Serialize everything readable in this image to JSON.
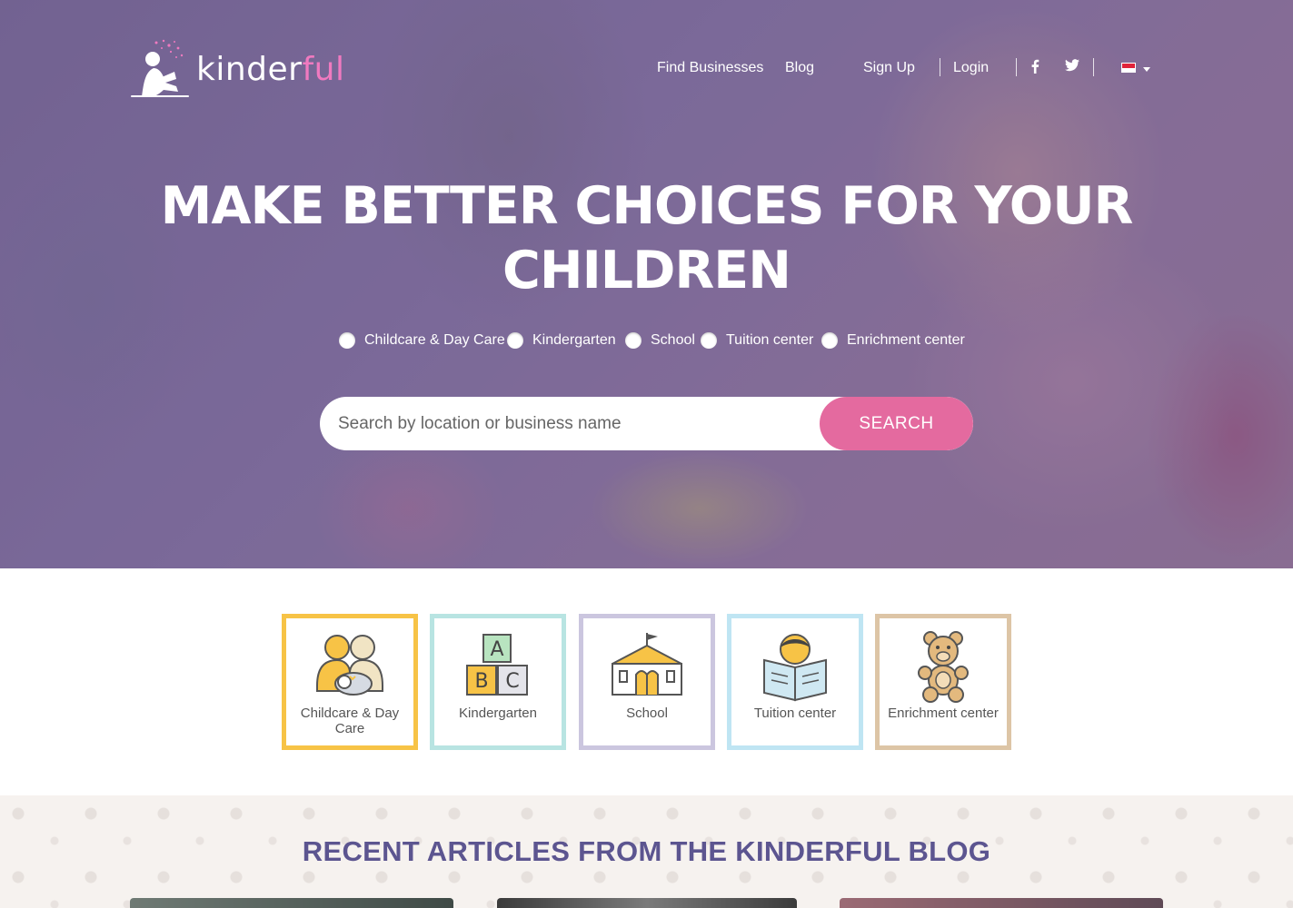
{
  "brand": {
    "name_prefix": "kinder",
    "name_suffix": "ful",
    "accent_color": "#e46a9f"
  },
  "nav": {
    "find_businesses": "Find Businesses",
    "blog": "Blog",
    "sign_up": "Sign Up",
    "login": "Login",
    "facebook_icon": "facebook-icon",
    "twitter_icon": "twitter-icon",
    "language_flag": "singapore-flag-icon"
  },
  "hero": {
    "headline_line1": "MAKE BETTER CHOICES FOR YOUR",
    "headline_line2": "CHILDREN",
    "filters": [
      {
        "label": "Childcare & Day Care"
      },
      {
        "label": "Kindergarten"
      },
      {
        "label": "School"
      },
      {
        "label": "Tuition center"
      },
      {
        "label": "Enrichment center"
      }
    ],
    "search": {
      "placeholder": "Search by location or business name",
      "button_label": "SEARCH"
    }
  },
  "categories": [
    {
      "label": "Childcare & Day Care",
      "border_color": "#f7c346",
      "icon": "family-icon"
    },
    {
      "label": "Kindergarten",
      "border_color": "#b8e4e2",
      "icon": "abc-blocks-icon"
    },
    {
      "label": "School",
      "border_color": "#cbc6df",
      "icon": "school-building-icon"
    },
    {
      "label": "Tuition center",
      "border_color": "#bfe5f3",
      "icon": "reading-child-icon"
    },
    {
      "label": "Enrichment center",
      "border_color": "#ddc5a6",
      "icon": "teddy-bear-icon"
    }
  ],
  "blog": {
    "title": "RECENT ARTICLES FROM THE KINDERFUL BLOG"
  }
}
